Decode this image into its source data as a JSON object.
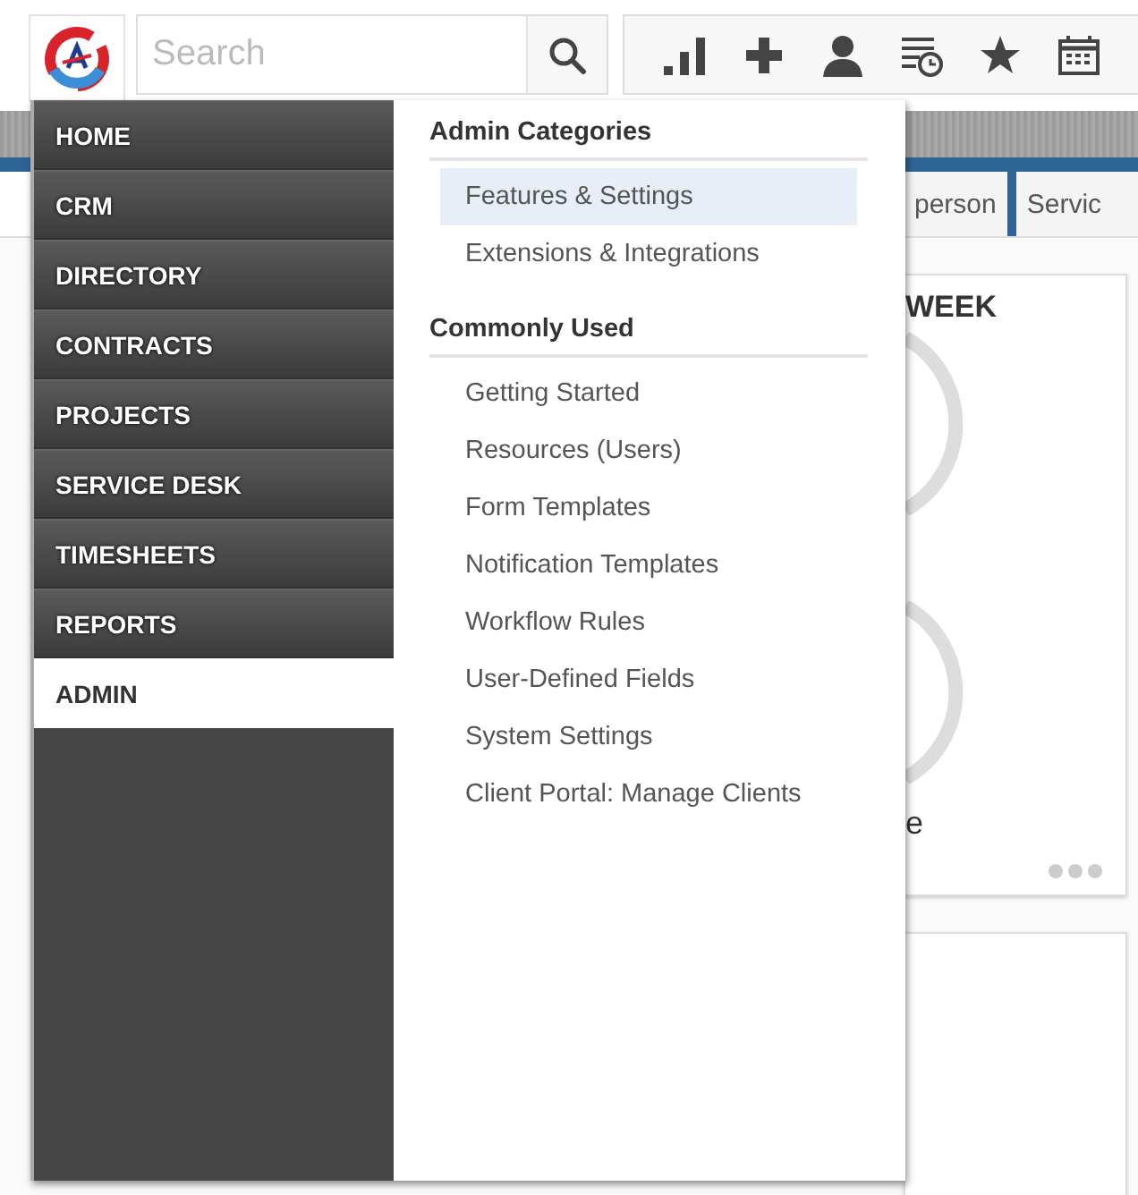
{
  "search": {
    "placeholder": "Search"
  },
  "nav": {
    "items": [
      {
        "label": "HOME",
        "selected": false
      },
      {
        "label": "CRM",
        "selected": false
      },
      {
        "label": "DIRECTORY",
        "selected": false
      },
      {
        "label": "CONTRACTS",
        "selected": false
      },
      {
        "label": "PROJECTS",
        "selected": false
      },
      {
        "label": "SERVICE DESK",
        "selected": false
      },
      {
        "label": "TIMESHEETS",
        "selected": false
      },
      {
        "label": "REPORTS",
        "selected": false
      },
      {
        "label": "ADMIN",
        "selected": true
      }
    ]
  },
  "admin_menu": {
    "sections": [
      {
        "title": "Admin Categories",
        "items": [
          {
            "label": "Features & Settings",
            "highlighted": true
          },
          {
            "label": "Extensions & Integrations",
            "highlighted": false
          }
        ]
      },
      {
        "title": "Commonly Used",
        "items": [
          {
            "label": "Getting Started",
            "highlighted": false
          },
          {
            "label": "Resources (Users)",
            "highlighted": false
          },
          {
            "label": "Form Templates",
            "highlighted": false
          },
          {
            "label": "Notification Templates",
            "highlighted": false
          },
          {
            "label": "Workflow Rules",
            "highlighted": false
          },
          {
            "label": "User-Defined Fields",
            "highlighted": false
          },
          {
            "label": "System Settings",
            "highlighted": false
          },
          {
            "label": "Client Portal: Manage Clients",
            "highlighted": false
          }
        ]
      }
    ]
  },
  "background": {
    "tabs": [
      {
        "label": "person"
      },
      {
        "label": "Servic"
      }
    ],
    "widget": {
      "title": "WEEK",
      "text": "e"
    }
  }
}
